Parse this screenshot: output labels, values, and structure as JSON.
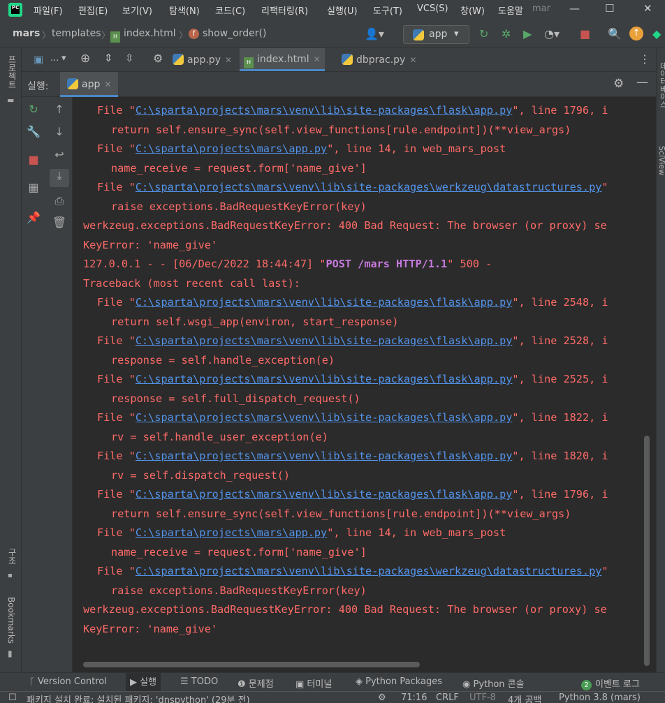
{
  "menubar": {
    "items": [
      "파일(F)",
      "편집(E)",
      "보기(V)",
      "탐색(N)",
      "코드(C)",
      "리팩터링(R)",
      "실행(U)",
      "도구(T)",
      "VCS(S)",
      "창(W)",
      "도움말",
      "mar"
    ],
    "logo_text": "PC"
  },
  "breadcrumb": {
    "items": [
      "mars",
      "templates",
      "index.html",
      "show_order()"
    ]
  },
  "run_config": {
    "label": "app"
  },
  "tabs": [
    {
      "label": "...",
      "active": false
    },
    {
      "label": "app.py",
      "active": false
    },
    {
      "label": "index.html",
      "active": true
    },
    {
      "label": "dbprac.py",
      "active": false
    }
  ],
  "run_panel": {
    "label": "실행:",
    "tab": "app"
  },
  "left_strip": {
    "project": "프로젝트",
    "structure": "구조",
    "bookmarks": "Bookmarks"
  },
  "right_strip": {
    "database": "데이터베이스",
    "sciview": "SciView"
  },
  "console": {
    "lines": [
      {
        "indent": 1,
        "parts": [
          {
            "t": "File \""
          },
          {
            "t": "C:\\sparta\\projects\\mars\\venv\\lib\\site-packages\\flask\\app.py",
            "k": "lnk"
          },
          {
            "t": "\", line 1796, i"
          }
        ]
      },
      {
        "indent": 2,
        "parts": [
          {
            "t": "return self.ensure_sync(self.view_functions[rule.endpoint])(**view_args)"
          }
        ]
      },
      {
        "indent": 1,
        "parts": [
          {
            "t": "File \""
          },
          {
            "t": "C:\\sparta\\projects\\mars\\app.py",
            "k": "lnk"
          },
          {
            "t": "\", line 14, in web_mars_post"
          }
        ]
      },
      {
        "indent": 2,
        "parts": [
          {
            "t": "name_receive = request.form['name_give']"
          }
        ]
      },
      {
        "indent": 1,
        "parts": [
          {
            "t": "File \""
          },
          {
            "t": "C:\\sparta\\projects\\mars\\venv\\lib\\site-packages\\werkzeug\\datastructures.py",
            "k": "lnk"
          },
          {
            "t": "\""
          }
        ]
      },
      {
        "indent": 2,
        "parts": [
          {
            "t": "raise exceptions.BadRequestKeyError(key)"
          }
        ]
      },
      {
        "indent": 0,
        "parts": [
          {
            "t": "werkzeug.exceptions.BadRequestKeyError: 400 Bad Request: The browser (or proxy) se"
          }
        ]
      },
      {
        "indent": 0,
        "parts": [
          {
            "t": "KeyError: 'name_give'"
          }
        ]
      },
      {
        "indent": 0,
        "parts": [
          {
            "t": "127.0.0.1 - - [06/Dec/2022 18:44:47] \""
          },
          {
            "t": "POST /mars HTTP/1.1",
            "k": "req"
          },
          {
            "t": "\" 500 -"
          }
        ]
      },
      {
        "indent": 0,
        "parts": [
          {
            "t": "Traceback (most recent call last):"
          }
        ]
      },
      {
        "indent": 1,
        "parts": [
          {
            "t": "File \""
          },
          {
            "t": "C:\\sparta\\projects\\mars\\venv\\lib\\site-packages\\flask\\app.py",
            "k": "lnk"
          },
          {
            "t": "\", line 2548, i"
          }
        ]
      },
      {
        "indent": 2,
        "parts": [
          {
            "t": "return self.wsgi_app(environ, start_response)"
          }
        ]
      },
      {
        "indent": 1,
        "parts": [
          {
            "t": "File \""
          },
          {
            "t": "C:\\sparta\\projects\\mars\\venv\\lib\\site-packages\\flask\\app.py",
            "k": "lnk"
          },
          {
            "t": "\", line 2528, i"
          }
        ]
      },
      {
        "indent": 2,
        "parts": [
          {
            "t": "response = self.handle_exception(e)"
          }
        ]
      },
      {
        "indent": 1,
        "parts": [
          {
            "t": "File \""
          },
          {
            "t": "C:\\sparta\\projects\\mars\\venv\\lib\\site-packages\\flask\\app.py",
            "k": "lnk"
          },
          {
            "t": "\", line 2525, i"
          }
        ]
      },
      {
        "indent": 2,
        "parts": [
          {
            "t": "response = self.full_dispatch_request()"
          }
        ]
      },
      {
        "indent": 1,
        "parts": [
          {
            "t": "File \""
          },
          {
            "t": "C:\\sparta\\projects\\mars\\venv\\lib\\site-packages\\flask\\app.py",
            "k": "lnk"
          },
          {
            "t": "\", line 1822, i"
          }
        ]
      },
      {
        "indent": 2,
        "parts": [
          {
            "t": "rv = self.handle_user_exception(e)"
          }
        ]
      },
      {
        "indent": 1,
        "parts": [
          {
            "t": "File \""
          },
          {
            "t": "C:\\sparta\\projects\\mars\\venv\\lib\\site-packages\\flask\\app.py",
            "k": "lnk"
          },
          {
            "t": "\", line 1820, i"
          }
        ]
      },
      {
        "indent": 2,
        "parts": [
          {
            "t": "rv = self.dispatch_request()"
          }
        ]
      },
      {
        "indent": 1,
        "parts": [
          {
            "t": "File \""
          },
          {
            "t": "C:\\sparta\\projects\\mars\\venv\\lib\\site-packages\\flask\\app.py",
            "k": "lnk"
          },
          {
            "t": "\", line 1796, i"
          }
        ]
      },
      {
        "indent": 2,
        "parts": [
          {
            "t": "return self.ensure_sync(self.view_functions[rule.endpoint])(**view_args)"
          }
        ]
      },
      {
        "indent": 1,
        "parts": [
          {
            "t": "File \""
          },
          {
            "t": "C:\\sparta\\projects\\mars\\app.py",
            "k": "lnk"
          },
          {
            "t": "\", line 14, in web_mars_post"
          }
        ]
      },
      {
        "indent": 2,
        "parts": [
          {
            "t": "name_receive = request.form['name_give']"
          }
        ]
      },
      {
        "indent": 1,
        "parts": [
          {
            "t": "File \""
          },
          {
            "t": "C:\\sparta\\projects\\mars\\venv\\lib\\site-packages\\werkzeug\\datastructures.py",
            "k": "lnk"
          },
          {
            "t": "\""
          }
        ]
      },
      {
        "indent": 2,
        "parts": [
          {
            "t": "raise exceptions.BadRequestKeyError(key)"
          }
        ]
      },
      {
        "indent": 0,
        "parts": [
          {
            "t": "werkzeug.exceptions.BadRequestKeyError: 400 Bad Request: The browser (or proxy) se"
          }
        ]
      },
      {
        "indent": 0,
        "parts": [
          {
            "t": "KeyError: 'name_give'"
          }
        ]
      }
    ]
  },
  "bottom_tools": [
    {
      "label": "Version Control",
      "icon": "version-control-icon"
    },
    {
      "label": "실행",
      "icon": "run-icon",
      "active": true
    },
    {
      "label": "TODO",
      "icon": "todo-icon"
    },
    {
      "label": "문제점",
      "icon": "problems-icon"
    },
    {
      "label": "터미널",
      "icon": "terminal-icon"
    },
    {
      "label": "Python Packages",
      "icon": "packages-icon"
    },
    {
      "label": "Python 콘솔",
      "icon": "python-console-icon"
    },
    {
      "label": "이벤트 로그",
      "icon": "event-log-icon",
      "badge": "2"
    }
  ],
  "statusbar": {
    "message": "패키지 설치 완료: 설치된 패키지: 'dnspython' (29분 전)",
    "position": "71:16",
    "line_sep": "CRLF",
    "encoding": "UTF-8",
    "indent": "4개 공백",
    "interpreter": "Python 3.8 (mars)"
  },
  "colors": {
    "error_text": "#ff6b68",
    "link": "#5394ec",
    "request": "#c679dd",
    "accent": "#4a88c7"
  }
}
